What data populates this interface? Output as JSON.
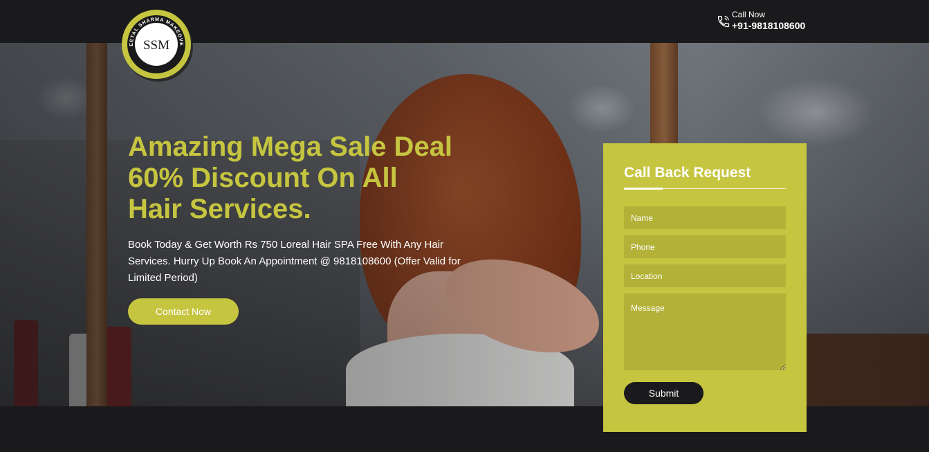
{
  "brand": {
    "logo_initials": "SSM",
    "logo_ring_text": "SHEETAL SHARMA MAKEOVERS",
    "accent_color": "#c6c540",
    "dark_color": "#1a191b"
  },
  "header": {
    "call_label": "Call Now",
    "call_number": "+91-9818108600",
    "phone_icon": "phone-icon"
  },
  "hero": {
    "headline_line1": "Amazing Mega Sale Deal",
    "headline_line2": "60% Discount On All",
    "headline_line3": "Hair Services.",
    "description": "Book Today & Get Worth Rs 750 Loreal Hair SPA Free With Any Hair Services. Hurry Up Book An Appointment @ 9818108600 (Offer Valid for Limited Period)",
    "cta_label": "Contact Now"
  },
  "callback_form": {
    "title": "Call Back Request",
    "name_placeholder": "Name",
    "phone_placeholder": "Phone",
    "location_placeholder": "Location",
    "message_placeholder": "Message",
    "submit_label": "Submit"
  }
}
